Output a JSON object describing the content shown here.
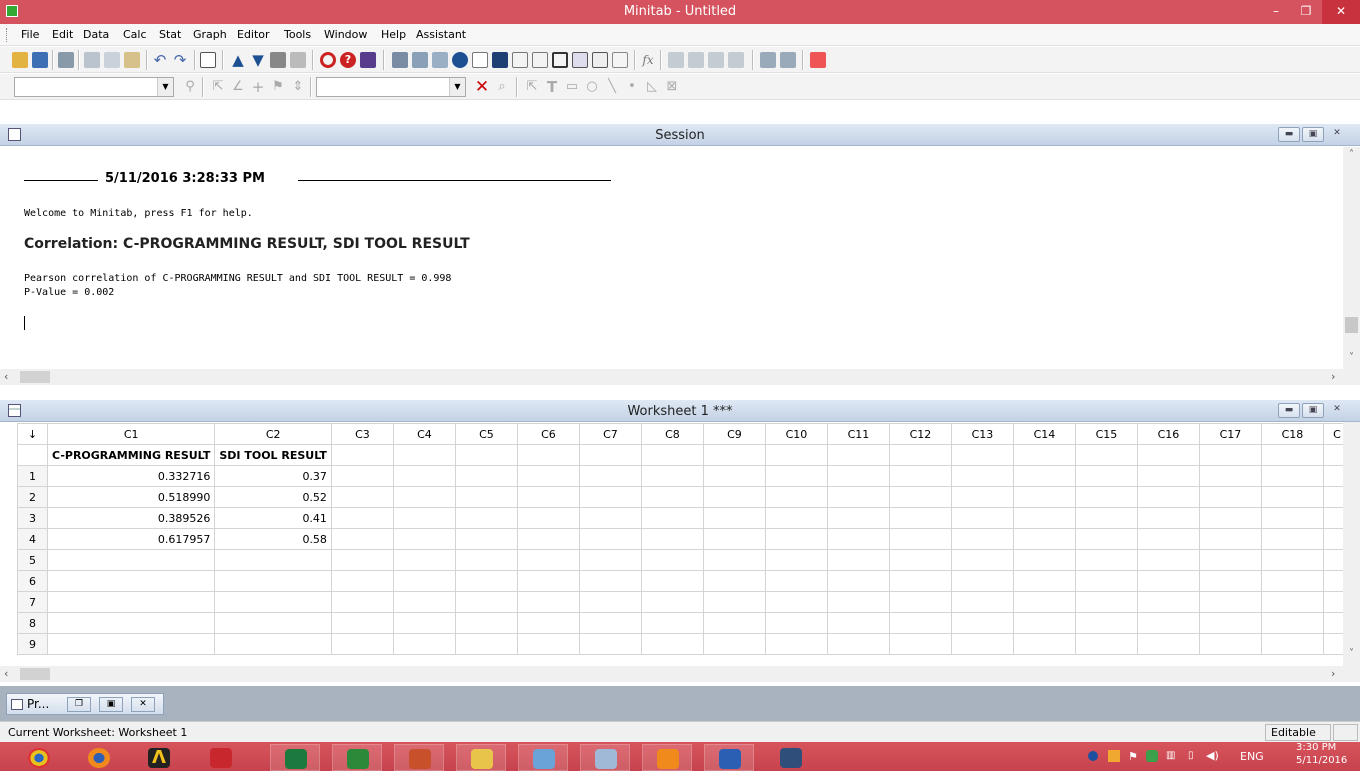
{
  "app": {
    "title": "Minitab - Untitled"
  },
  "menu": [
    "File",
    "Edit",
    "Data",
    "Calc",
    "Stat",
    "Graph",
    "Editor",
    "Tools",
    "Window",
    "Help",
    "Assistant"
  ],
  "session": {
    "title": "Session",
    "timestamp": "5/11/2016 3:28:33 PM",
    "welcome": "Welcome to Minitab, press F1 for help.",
    "heading": "Correlation: C-PROGRAMMING RESULT, SDI TOOL RESULT",
    "pearson_line": "Pearson correlation of C-PROGRAMMING RESULT and SDI TOOL RESULT = 0.998",
    "pvalue_line": "P-Value = 0.002"
  },
  "worksheet": {
    "title": "Worksheet 1 ***",
    "columns": [
      "C1",
      "C2",
      "C3",
      "C4",
      "C5",
      "C6",
      "C7",
      "C8",
      "C9",
      "C10",
      "C11",
      "C12",
      "C13",
      "C14",
      "C15",
      "C16",
      "C17",
      "C18",
      "C"
    ],
    "names": [
      "C-PROGRAMMING RESULT",
      "SDI TOOL RESULT"
    ],
    "rows": [
      {
        "n": "1",
        "c1": "0.332716",
        "c2": "0.37"
      },
      {
        "n": "2",
        "c1": "0.518990",
        "c2": "0.52"
      },
      {
        "n": "3",
        "c1": "0.389526",
        "c2": "0.41"
      },
      {
        "n": "4",
        "c1": "0.617957",
        "c2": "0.58"
      },
      {
        "n": "5",
        "c1": "",
        "c2": ""
      },
      {
        "n": "6",
        "c1": "",
        "c2": ""
      },
      {
        "n": "7",
        "c1": "",
        "c2": ""
      },
      {
        "n": "8",
        "c1": "",
        "c2": ""
      },
      {
        "n": "9",
        "c1": "",
        "c2": ""
      }
    ]
  },
  "minimized": {
    "label": "Pr..."
  },
  "status": {
    "text": "Current Worksheet: Worksheet 1",
    "mode": "Editable"
  },
  "tray": {
    "lang": "ENG",
    "time": "3:30 PM",
    "date": "5/11/2016"
  }
}
